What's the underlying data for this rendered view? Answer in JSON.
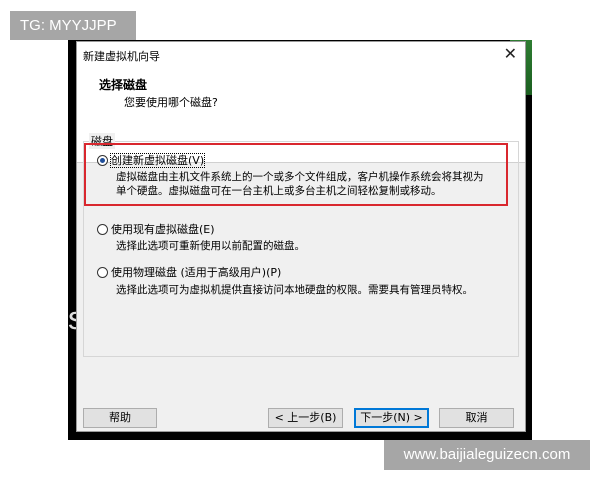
{
  "watermarks": {
    "top": "TG: MYYJJPP",
    "bottom": "www.baijialeguizecn.com"
  },
  "background": {
    "glyph": "s"
  },
  "dialog": {
    "title": "新建虚拟机向导",
    "header": {
      "title": "选择磁盘",
      "subtitle": "您要使用哪个磁盘?"
    },
    "group_label": "磁盘",
    "options": [
      {
        "label": "创建新虚拟磁盘(V)",
        "checked": true,
        "desc": [
          "虚拟磁盘由主机文件系统上的一个或多个文件组成，客户机操作系统会将其视为",
          "单个硬盘。虚拟磁盘可在一台主机上或多台主机之间轻松复制或移动。"
        ]
      },
      {
        "label": "使用现有虚拟磁盘(E)",
        "checked": false,
        "desc": [
          "选择此选项可重新使用以前配置的磁盘。"
        ]
      },
      {
        "label": "使用物理磁盘 (适用于高级用户)(P)",
        "checked": false,
        "desc": [
          "选择此选项可为虚拟机提供直接访问本地硬盘的权限。需要具有管理员特权。"
        ]
      }
    ],
    "buttons": {
      "help": "帮助",
      "back": "< 上一步(B)",
      "next": "下一步(N) >",
      "cancel": "取消"
    },
    "colors": {
      "highlight": "#d9272e",
      "default_button_border": "#0078d7"
    },
    "icons": {
      "close": "close-icon"
    }
  }
}
